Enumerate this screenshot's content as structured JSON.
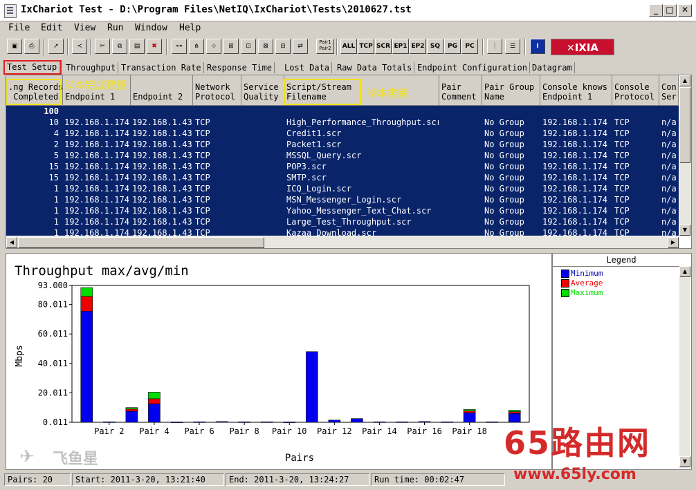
{
  "window": {
    "title": "IxChariot Test - D:\\Program Files\\NetIQ\\IxChariot\\Tests\\2010627.tst",
    "min": "_",
    "max": "□",
    "close": "✕"
  },
  "menu": [
    "File",
    "Edit",
    "View",
    "Run",
    "Window",
    "Help"
  ],
  "toolbar": {
    "text_buttons": [
      "ALL",
      "TCP",
      "SCR",
      "EP1",
      "EP2",
      "SQ",
      "PG",
      "PC"
    ],
    "pair_button": "Pair1 Pair2",
    "logo": "IXIA"
  },
  "tabs": [
    "Test Setup",
    "Throughput",
    "Transaction Rate",
    "Response Time",
    "Lost Data",
    "Raw Data Totals",
    "Endpoint Configuration",
    "Datagram"
  ],
  "grid": {
    "columns": [
      ".ng Records\n Completed",
      "\nEndpoint 1",
      "\nEndpoint 2",
      "Network\nProtocol",
      "Service\nQuality",
      "Script/Stream\nFilename",
      "Pair\nComment",
      "Pair Group\nName",
      "Console knows\nEndpoint 1",
      "Console\nProtocol",
      "Con\nSer"
    ],
    "total_row": "100",
    "rows": [
      [
        "10",
        "192.168.1.174",
        "192.168.1.43",
        "TCP",
        "",
        "High_Performance_Throughput.scr",
        "",
        "No Group",
        "192.168.1.174",
        "TCP",
        "n/a"
      ],
      [
        "4",
        "192.168.1.174",
        "192.168.1.43",
        "TCP",
        "",
        "Credit1.scr",
        "",
        "No Group",
        "192.168.1.174",
        "TCP",
        "n/a"
      ],
      [
        "2",
        "192.168.1.174",
        "192.168.1.43",
        "TCP",
        "",
        "Packet1.scr",
        "",
        "No Group",
        "192.168.1.174",
        "TCP",
        "n/a"
      ],
      [
        "5",
        "192.168.1.174",
        "192.168.1.43",
        "TCP",
        "",
        "MSSQL_Query.scr",
        "",
        "No Group",
        "192.168.1.174",
        "TCP",
        "n/a"
      ],
      [
        "15",
        "192.168.1.174",
        "192.168.1.43",
        "TCP",
        "",
        "POP3.scr",
        "",
        "No Group",
        "192.168.1.174",
        "TCP",
        "n/a"
      ],
      [
        "15",
        "192.168.1.174",
        "192.168.1.43",
        "TCP",
        "",
        "SMTP.scr",
        "",
        "No Group",
        "192.168.1.174",
        "TCP",
        "n/a"
      ],
      [
        "1",
        "192.168.1.174",
        "192.168.1.43",
        "TCP",
        "",
        "ICQ_Login.scr",
        "",
        "No Group",
        "192.168.1.174",
        "TCP",
        "n/a"
      ],
      [
        "1",
        "192.168.1.174",
        "192.168.1.43",
        "TCP",
        "",
        "MSN_Messenger_Login.scr",
        "",
        "No Group",
        "192.168.1.174",
        "TCP",
        "n/a"
      ],
      [
        "1",
        "192.168.1.174",
        "192.168.1.43",
        "TCP",
        "",
        "Yahoo_Messenger_Text_Chat.scr",
        "",
        "No Group",
        "192.168.1.174",
        "TCP",
        "n/a"
      ],
      [
        "1",
        "192.168.1.174",
        "192.168.1.43",
        "TCP",
        "",
        "Large_Test_Throughput.scr",
        "",
        "No Group",
        "192.168.1.174",
        "TCP",
        "n/a"
      ],
      [
        "1",
        "192.168.1.174",
        "192.168.1.43",
        "TCP",
        "",
        "Kazaa_Download.scr",
        "",
        "No Group",
        "192.168.1.174",
        "TCP",
        "n/a"
      ]
    ]
  },
  "annotations": {
    "records_label": "脚本完成数量",
    "script_label": "脚本类别"
  },
  "chart_data": {
    "type": "bar",
    "stacked": true,
    "title": "Throughput max/avg/min",
    "xlabel": "Pairs",
    "ylabel": "Mbps",
    "ylim": [
      0.011,
      93.0
    ],
    "yticks": [
      "0.011",
      "20.011",
      "40.011",
      "60.011",
      "80.011",
      "93.000"
    ],
    "ytick_values": [
      0.011,
      20.011,
      40.011,
      60.011,
      80.011,
      93.0
    ],
    "categories": [
      "Pair 1",
      "Pair 2",
      "Pair 3",
      "Pair 4",
      "Pair 5",
      "Pair 6",
      "Pair 7",
      "Pair 8",
      "Pair 9",
      "Pair 10",
      "Pair 11",
      "Pair 12",
      "Pair 13",
      "Pair 14",
      "Pair 15",
      "Pair 16",
      "Pair 17",
      "Pair 18",
      "Pair 19",
      "Pair 20"
    ],
    "xtick_labels": [
      "Pair 2",
      "Pair 4",
      "Pair 6",
      "Pair 8",
      "Pair 10",
      "Pair 12",
      "Pair 14",
      "Pair 16",
      "Pair 18"
    ],
    "series": [
      {
        "name": "Minimum",
        "color": "#0000ee",
        "values": [
          75.5,
          0.3,
          7.5,
          12.5,
          0.2,
          0.3,
          0.5,
          0.3,
          0.3,
          0.2,
          48.0,
          1.5,
          2.5,
          0.3,
          0.3,
          0.5,
          0.3,
          6.5,
          0.3,
          6.0
        ]
      },
      {
        "name": "Average",
        "color": "#ee0000",
        "values": [
          10.0,
          0,
          1.5,
          3.5,
          0,
          0,
          0,
          0,
          0,
          0,
          0,
          0,
          0,
          0,
          0,
          0,
          0,
          1.2,
          0,
          1.2
        ]
      },
      {
        "name": "Maximum",
        "color": "#00dd00",
        "values": [
          6.0,
          0,
          1.0,
          4.5,
          0,
          0,
          0,
          0,
          0,
          0,
          0,
          0,
          0,
          0,
          0,
          0,
          0,
          1.0,
          0,
          1.0
        ]
      }
    ],
    "legend_title": "Legend",
    "legend_position": "right"
  },
  "status": {
    "pairs": "Pairs: 20",
    "start": "Start: 2011-3-20, 13:21:40",
    "end": "End: 2011-3-20, 13:24:27",
    "runtime": "Run time: 00:02:47"
  },
  "watermark": {
    "brand": "飞鱼星",
    "site_cn": "65路由网",
    "site_url": "www.65ly.com"
  }
}
